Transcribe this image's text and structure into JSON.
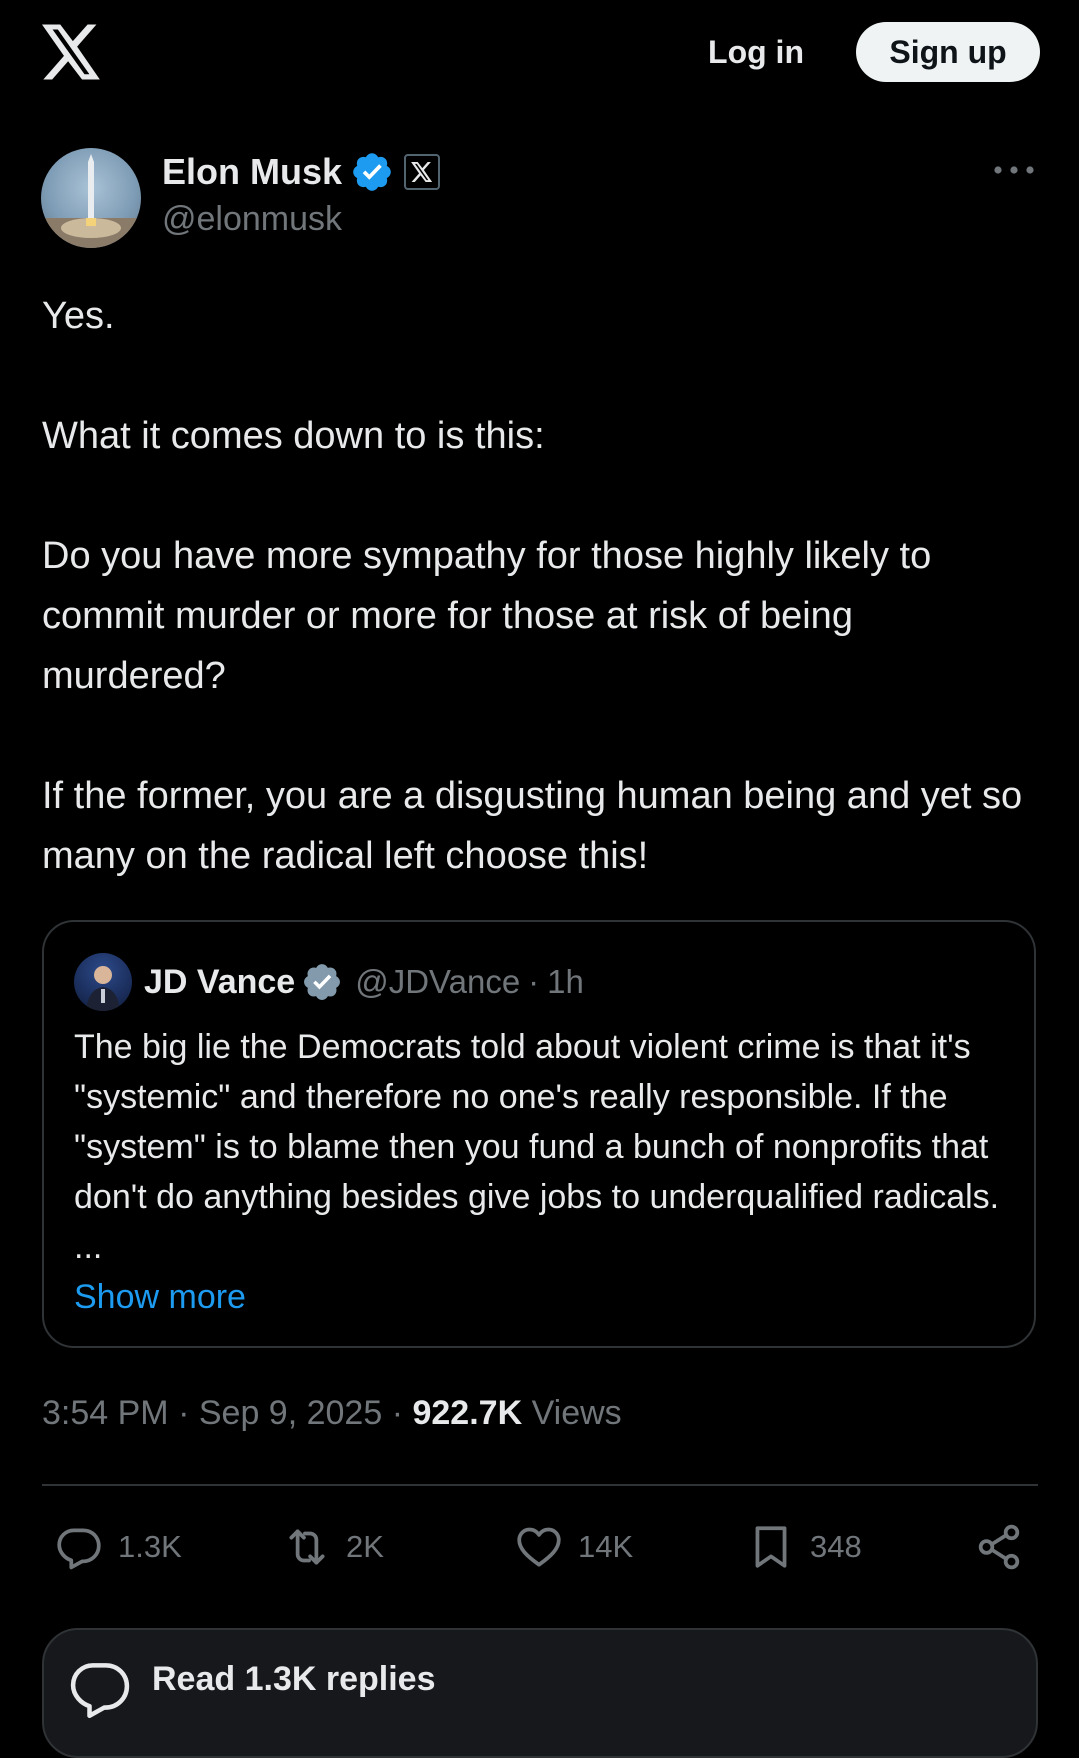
{
  "header": {
    "logo_icon": "x-logo-icon",
    "login_label": "Log in",
    "signup_label": "Sign up"
  },
  "author": {
    "name": "Elon Musk",
    "handle": "@elonmusk",
    "verified_icon": "verified-badge-icon",
    "affiliate_icon": "x-affiliate-badge-icon"
  },
  "tweet": {
    "paragraphs": [
      "Yes.",
      "What it comes down to is this:",
      "Do you have more sympathy for those highly likely to commit murder or more for those at risk of being murdered?",
      "If the former, you are a disgusting human being and yet so many on the radical left choose this!"
    ]
  },
  "quote": {
    "name": "JD Vance",
    "handle": "@JDVance",
    "separator": "·",
    "time": "1h",
    "text": "The big lie the Democrats told about violent crime is that it's \"systemic\" and therefore no one's really responsible. If the \"system\" is to blame then you fund a bunch of nonprofits that don't do anything besides give jobs to underqualified radicals. ...",
    "show_more": "Show more"
  },
  "meta": {
    "time": "3:54 PM",
    "date": "Sep 9, 2025",
    "separator": "·",
    "views": "922.7K",
    "views_label": "Views"
  },
  "actions": {
    "replies": "1.3K",
    "reposts": "2K",
    "likes": "14K",
    "bookmarks": "348"
  },
  "read_replies": {
    "label": "Read 1.3K replies"
  },
  "colors": {
    "background": "#000000",
    "text": "#e7e9ea",
    "muted": "#71767b",
    "accent": "#1d9bf0",
    "border": "#2f3336"
  }
}
